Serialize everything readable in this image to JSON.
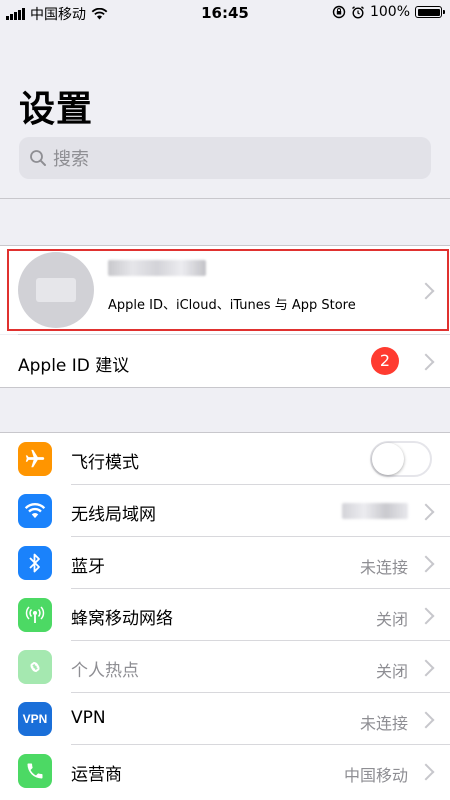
{
  "status_bar": {
    "carrier": "中国移动",
    "time": "16:45",
    "battery_pct": "100%"
  },
  "page_title": "设置",
  "search": {
    "placeholder": "搜索"
  },
  "profile": {
    "subtitle": "Apple ID、iCloud、iTunes 与 App Store"
  },
  "apple_id_suggestions": {
    "label": "Apple ID 建议",
    "badge": "2"
  },
  "settings": [
    {
      "label": "飞行模式",
      "icon": "airplane-icon",
      "color": "#ff9500",
      "control": "toggle",
      "on": false
    },
    {
      "label": "无线局域网",
      "icon": "wifi-icon",
      "color": "#1a82fb",
      "control": "value",
      "value": ""
    },
    {
      "label": "蓝牙",
      "icon": "bluetooth-icon",
      "color": "#1a82fb",
      "control": "value",
      "value": "未连接"
    },
    {
      "label": "蜂窝移动网络",
      "icon": "cellular-icon",
      "color": "#4cd964",
      "control": "value",
      "value": "关闭"
    },
    {
      "label": "个人热点",
      "icon": "hotspot-icon",
      "color": "#a5e8b0",
      "control": "value",
      "value": "关闭"
    },
    {
      "label": "VPN",
      "icon": "vpn-icon",
      "color": "#1a6fd9",
      "control": "value",
      "value": "未连接"
    },
    {
      "label": "运营商",
      "icon": "phone-icon",
      "color": "#4cd964",
      "control": "value",
      "value": "中国移动"
    }
  ]
}
